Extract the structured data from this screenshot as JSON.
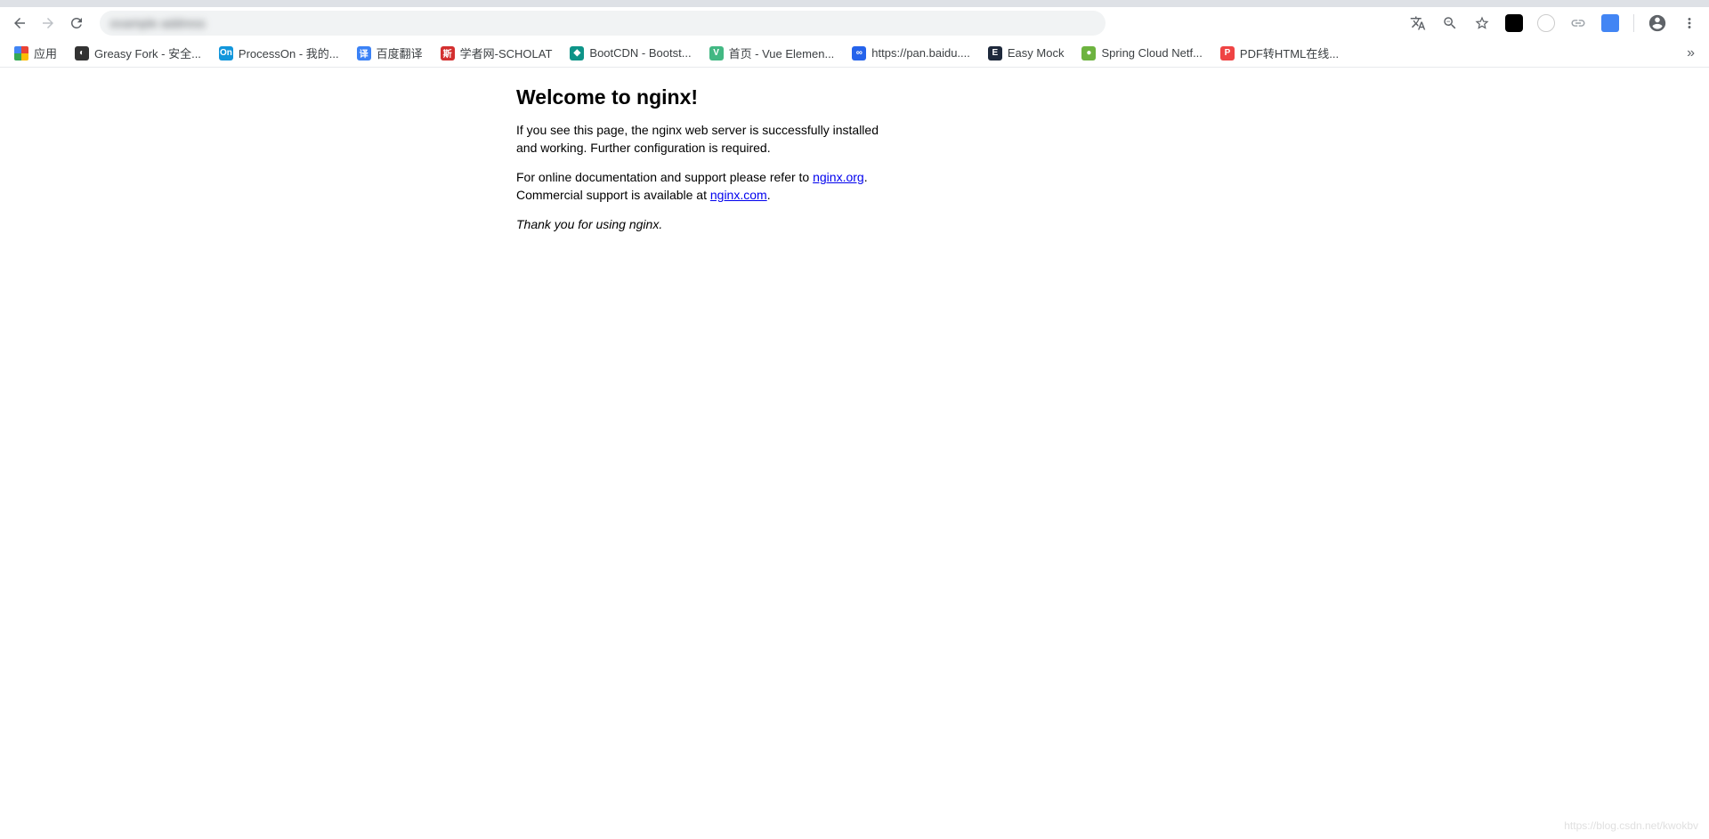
{
  "toolbar": {
    "omnibox_text": "example address"
  },
  "bookmarks": {
    "apps_label": "应用",
    "items": [
      {
        "label": "Greasy Fork - 安全...",
        "bg": "#333",
        "glyph": "◐"
      },
      {
        "label": "ProcessOn - 我的...",
        "bg": "#1296db",
        "glyph": "On"
      },
      {
        "label": "百度翻译",
        "bg": "#3b82f6",
        "glyph": "译"
      },
      {
        "label": "学者网-SCHOLAT",
        "bg": "#d32f2f",
        "glyph": "斯"
      },
      {
        "label": "BootCDN - Bootst...",
        "bg": "#0d9488",
        "glyph": "◆"
      },
      {
        "label": "首页 - Vue Elemen...",
        "bg": "#42b883",
        "glyph": "V"
      },
      {
        "label": "https://pan.baidu....",
        "bg": "#2563eb",
        "glyph": "∞"
      },
      {
        "label": "Easy Mock",
        "bg": "#1e293b",
        "glyph": "E"
      },
      {
        "label": "Spring Cloud Netf...",
        "bg": "#6db33f",
        "glyph": "●"
      },
      {
        "label": "PDF转HTML在线...",
        "bg": "#ef4444",
        "glyph": "P"
      }
    ]
  },
  "page": {
    "heading": "Welcome to nginx!",
    "para1": "If you see this page, the nginx web server is successfully installed and working. Further configuration is required.",
    "para2_a": "For online documentation and support please refer to ",
    "link1": "nginx.org",
    "para2_b": ".",
    "para2_c": "Commercial support is available at ",
    "link2": "nginx.com",
    "para2_d": ".",
    "thanks": "Thank you for using nginx."
  },
  "watermark": "https://blog.csdn.net/kwokbv"
}
